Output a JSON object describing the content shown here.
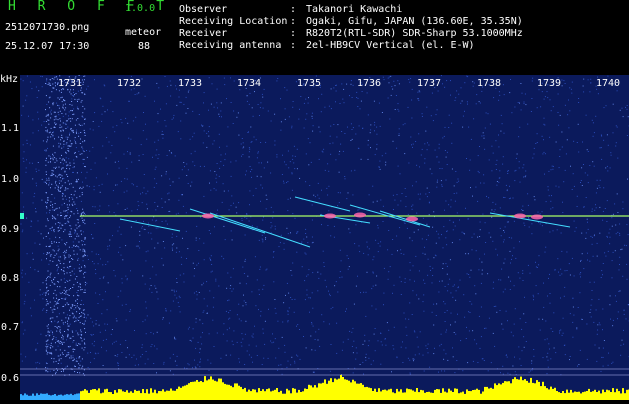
{
  "header": {
    "logo": "H R O F F T",
    "version": "1.0.0",
    "filename": "2512071730.png",
    "meteor_label": "meteor",
    "datetime": "25.12.07 17:30",
    "meteor_count": "88"
  },
  "info": [
    {
      "label": "Observer",
      "value": "Takanori Kawachi"
    },
    {
      "label": "Receiving Location",
      "value": "Ogaki, Gifu, JAPAN (136.60E, 35.35N)"
    },
    {
      "label": "Receiver",
      "value": "R820T2(RTL-SDR) SDR-Sharp 53.1000MHz"
    },
    {
      "label": "Receiving antenna",
      "value": "2el-HB9CV Vertical (el. E-W)"
    }
  ],
  "axis": {
    "unit": "kHz",
    "y_ticks": [
      "1.1",
      "1.0",
      "0.9",
      "0.8",
      "0.7",
      "0.6"
    ],
    "x_ticks": [
      "1731",
      "1732",
      "1733",
      "1734",
      "1735",
      "1736",
      "1737",
      "1738",
      "1739",
      "1740"
    ]
  },
  "colors": {
    "background": "#000000",
    "spectrogram_bg": "#0b1a5c",
    "noise": "#2a4bb8",
    "carrier": "#aaff66",
    "echo": "#ff66aa",
    "level_bars": "#ffff00",
    "text_white": "#ffffff",
    "text_green": "#33dd33"
  }
}
